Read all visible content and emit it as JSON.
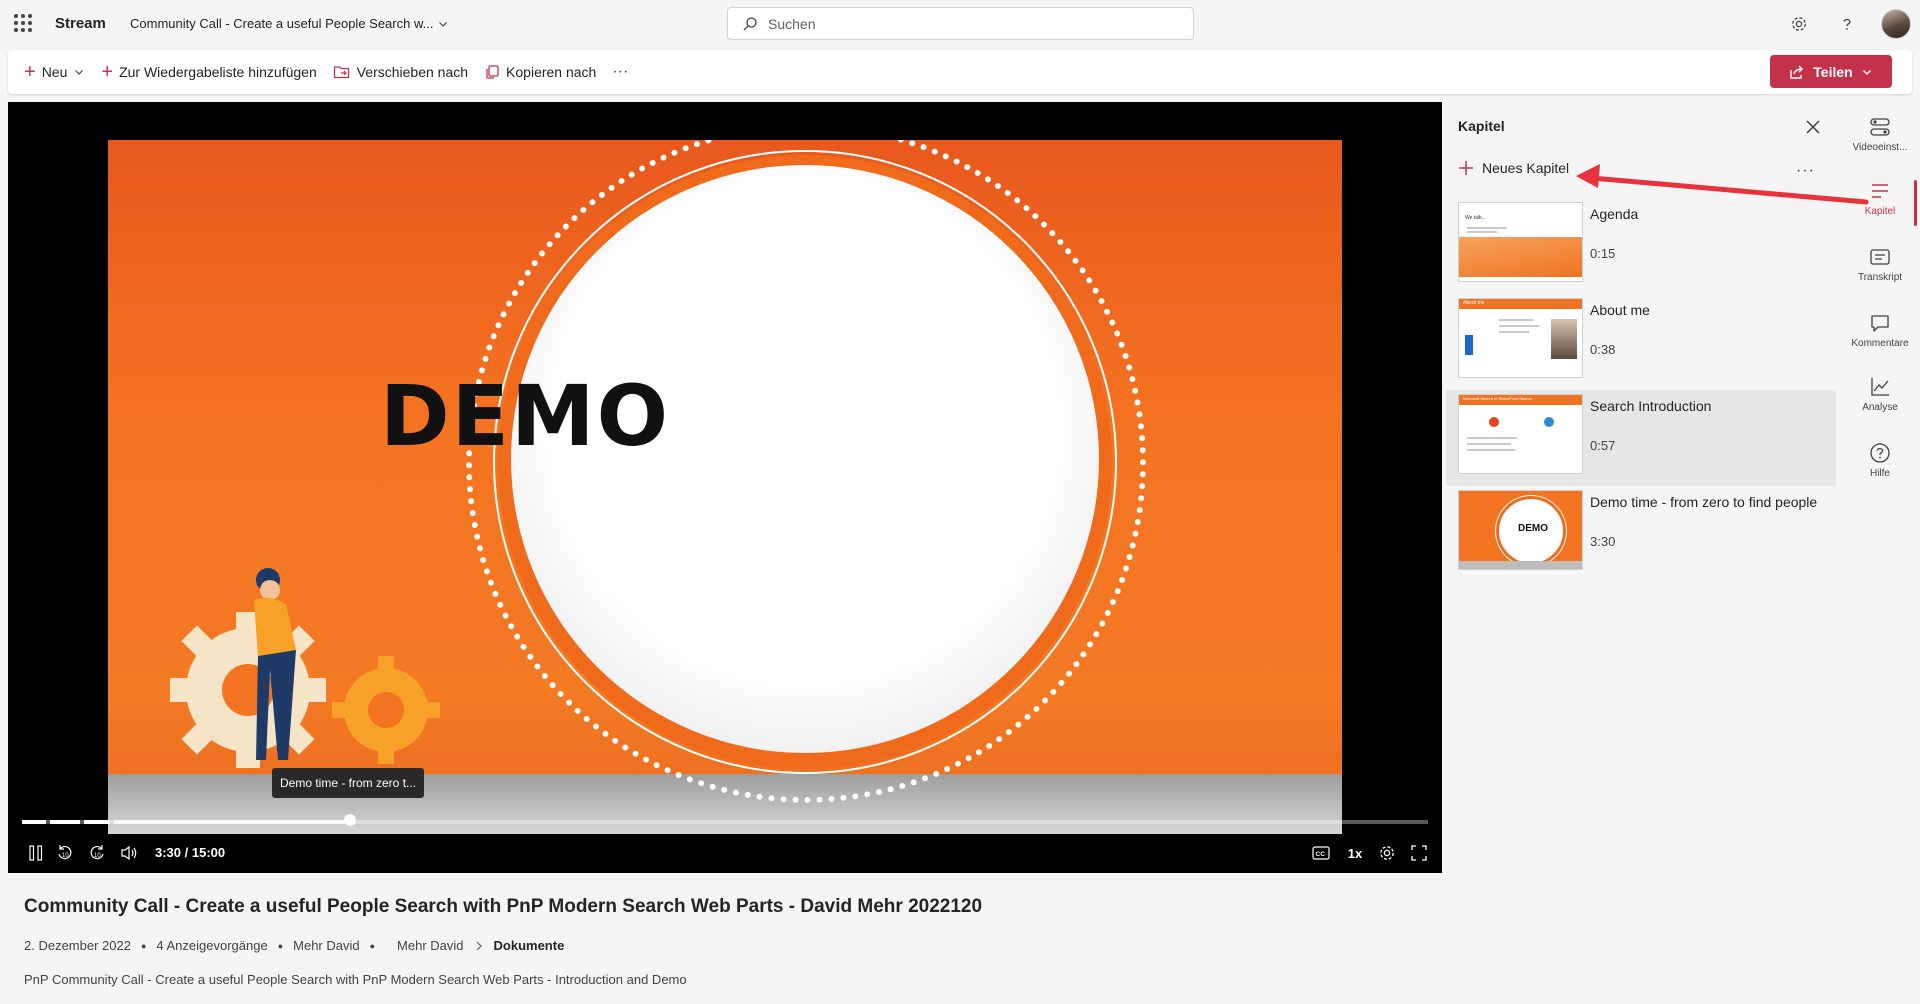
{
  "topbar": {
    "app_name": "Stream",
    "doc_title": "Community Call - Create a useful People Search w...",
    "search_placeholder": "Suchen"
  },
  "commandbar": {
    "new_label": "Neu",
    "add_to_playlist_label": "Zur Wiedergabeliste hinzufügen",
    "move_to_label": "Verschieben nach",
    "copy_to_label": "Kopieren nach",
    "more_label": "···",
    "share_label": "Teilen"
  },
  "player": {
    "slide_text": "DEMO",
    "chapter_tooltip": "Demo time - from zero t...",
    "time_display": "3:30 / 15:00",
    "progress_fraction": 0.233,
    "speed_label": "1x",
    "skip_back_label": "10",
    "skip_forward_label": "10"
  },
  "video": {
    "title": "Community Call - Create a useful People Search with PnP Modern Search Web Parts - David Mehr 2022120",
    "date": "2. Dezember 2022",
    "views": "4 Anzeigevorgänge",
    "owner": "Mehr David",
    "path_owner": "Mehr David",
    "path_folder": "Dokumente",
    "description": "PnP Community Call - Create a useful People Search with PnP Modern Search Web Parts - Introduction and Demo"
  },
  "chapters_panel": {
    "title": "Kapitel",
    "new_chapter_label": "Neues Kapitel",
    "more_label": "···",
    "items": [
      {
        "name": "Agenda",
        "time": "0:15",
        "thumb_text": "We talk..."
      },
      {
        "name": "About me",
        "time": "0:38",
        "thumb_text": "About me"
      },
      {
        "name": "Search Introduction",
        "time": "0:57",
        "thumb_text": "Microsoft Search in SharePoint Search"
      },
      {
        "name": "Demo time - from zero to find people",
        "time": "3:30",
        "thumb_text": "DEMO"
      }
    ]
  },
  "rail": {
    "items": [
      {
        "label": "Videoeinst...",
        "icon": "video-settings-icon"
      },
      {
        "label": "Kapitel",
        "icon": "chapters-icon"
      },
      {
        "label": "Transkript",
        "icon": "transcript-icon"
      },
      {
        "label": "Kommentare",
        "icon": "comments-icon"
      },
      {
        "label": "Analyse",
        "icon": "analytics-icon"
      },
      {
        "label": "Hilfe",
        "icon": "help-icon"
      }
    ]
  },
  "colors": {
    "accent": "#c4314b",
    "slide_orange": "#f47321",
    "annotation_arrow": "#e8333c"
  }
}
